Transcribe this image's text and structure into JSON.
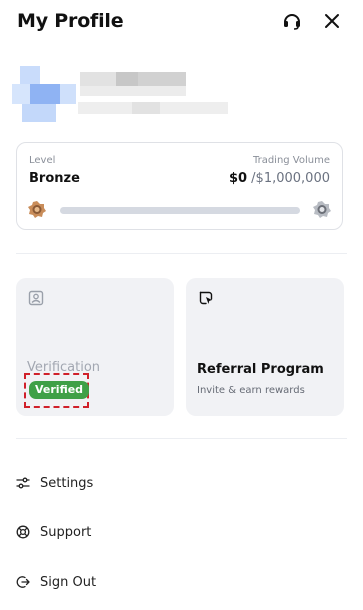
{
  "header": {
    "title": "My Profile",
    "support_icon": "headset-icon",
    "close_icon": "close-icon"
  },
  "level_card": {
    "level_label": "Level",
    "level_value": "Bronze",
    "volume_label": "Trading Volume",
    "volume_current": "$0",
    "volume_target": " /$1,000,000",
    "progress_fraction": 0.0,
    "current_badge_icon": "bronze-medal-icon",
    "next_badge_icon": "silver-medal-icon"
  },
  "tiles": {
    "verification": {
      "title": "Verification",
      "status": "Verified",
      "icon": "id-card-icon"
    },
    "referral": {
      "title": "Referral Program",
      "subtitle": "Invite & earn rewards",
      "icon": "tag-share-icon"
    }
  },
  "menu": [
    {
      "label": "Settings",
      "icon": "sliders-icon"
    },
    {
      "label": "Support",
      "icon": "lifebuoy-icon"
    },
    {
      "label": "Sign Out",
      "icon": "sign-out-icon"
    }
  ],
  "colors": {
    "verified_badge": "#3fa047",
    "highlight_border": "#d0202a",
    "tile_bg": "#f1f2f5"
  }
}
